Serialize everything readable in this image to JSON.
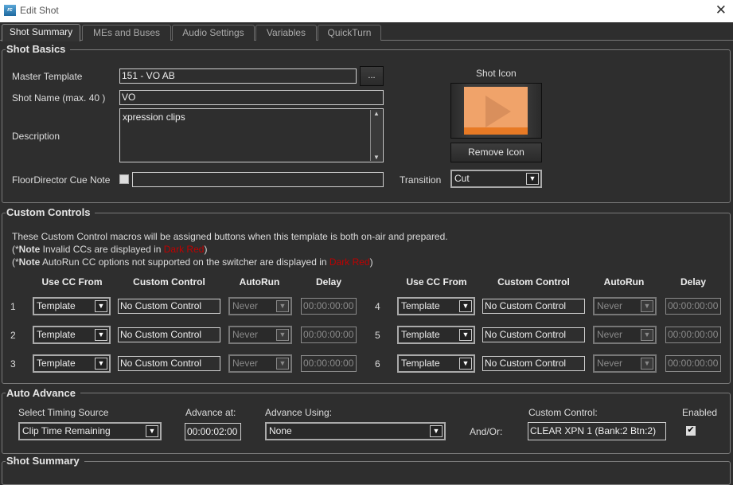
{
  "window": {
    "title": "Edit Shot",
    "icon_text": "rc"
  },
  "tabs": [
    "Shot Summary",
    "MEs and Buses",
    "Audio Settings",
    "Variables",
    "QuickTurn"
  ],
  "shot_basics": {
    "title": "Shot Basics",
    "master_template_label": "Master Template",
    "master_template_value": "151 - VO AB",
    "browse_label": "...",
    "shot_name_label": "Shot Name (max. 40 )",
    "shot_name_value": "VO",
    "description_label": "Description",
    "description_value": "xpression clips",
    "floor_director_label": "FloorDirector Cue Note",
    "floor_director_value": "",
    "shot_icon_label": "Shot Icon",
    "remove_icon_label": "Remove Icon",
    "transition_label": "Transition",
    "transition_value": "Cut",
    "icon_colors": {
      "bg": "#f0a36a",
      "bar": "#e87a25",
      "play": "#d98f5c"
    }
  },
  "custom_controls": {
    "title": "Custom Controls",
    "info": "These Custom Control macros will be assigned buttons when this template is both on-air and prepared.",
    "note1_prefix": "(*",
    "note_bold": "Note",
    "note1_text": " Invalid CCs are displayed in ",
    "dark_red": "Dark Red",
    "note_close": ")",
    "note2_text": " AutoRun CC options not supported on the switcher are displayed in ",
    "headers": [
      "Use CC From",
      "Custom Control",
      "AutoRun",
      "Delay"
    ],
    "rows": [
      {
        "num": "1",
        "from": "Template",
        "control": "No Custom Control",
        "autorun": "Never",
        "delay": "00:00:00:00"
      },
      {
        "num": "2",
        "from": "Template",
        "control": "No Custom Control",
        "autorun": "Never",
        "delay": "00:00:00:00"
      },
      {
        "num": "3",
        "from": "Template",
        "control": "No Custom Control",
        "autorun": "Never",
        "delay": "00:00:00:00"
      },
      {
        "num": "4",
        "from": "Template",
        "control": "No Custom Control",
        "autorun": "Never",
        "delay": "00:00:00:00"
      },
      {
        "num": "5",
        "from": "Template",
        "control": "No Custom Control",
        "autorun": "Never",
        "delay": "00:00:00:00"
      },
      {
        "num": "6",
        "from": "Template",
        "control": "No Custom Control",
        "autorun": "Never",
        "delay": "00:00:00:00"
      }
    ]
  },
  "auto_advance": {
    "title": "Auto Advance",
    "timing_label": "Select Timing Source",
    "timing_value": "Clip Time Remaining",
    "advance_at_label": "Advance at:",
    "advance_at_value": "00:00:02:00",
    "advance_using_label": "Advance Using:",
    "advance_using_value": "None",
    "andor_label": "And/Or:",
    "cc_label": "Custom Control:",
    "cc_value": "CLEAR XPN 1 (Bank:2 Btn:2)",
    "enabled_label": "Enabled",
    "enabled": true
  },
  "shot_summary": {
    "title": "Shot Summary"
  }
}
